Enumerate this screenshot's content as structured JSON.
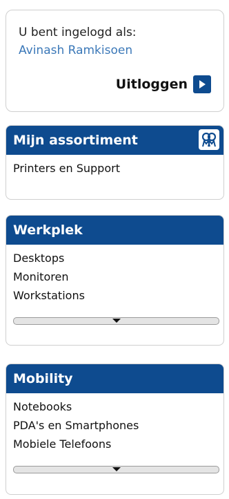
{
  "login": {
    "label": "U bent ingelogd als:",
    "user": "Avinash Ramkisoen",
    "logout_label": "Uitloggen"
  },
  "sections": [
    {
      "title": "Mijn assortiment",
      "icon": "people-icon",
      "items": [
        "Printers en Support"
      ]
    },
    {
      "title": "Werkplek",
      "items": [
        "Desktops",
        "Monitoren",
        "Workstations"
      ]
    },
    {
      "title": "Mobility",
      "items": [
        "Notebooks",
        "PDA's en Smartphones",
        "Mobiele Telefoons"
      ]
    }
  ],
  "colors": {
    "header_bg": "#0e4b8f",
    "link": "#3b78b8",
    "border": "#cfcfcf"
  }
}
